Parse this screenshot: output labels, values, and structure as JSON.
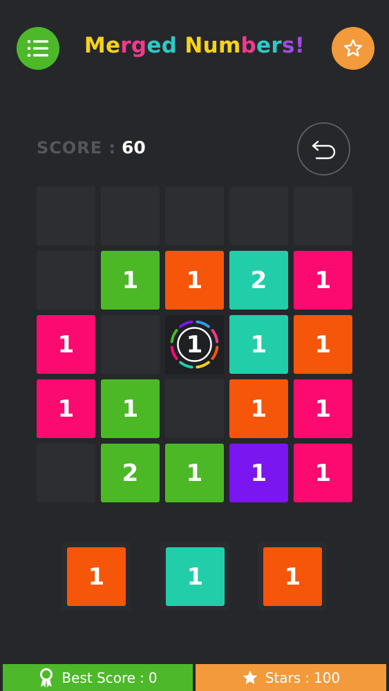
{
  "header": {
    "menu_icon": "list-icon",
    "star_icon": "star-outline-icon",
    "title_letters": [
      {
        "ch": "M",
        "color": "#f6d21c"
      },
      {
        "ch": "e",
        "color": "#f6d21c"
      },
      {
        "ch": "r",
        "color": "#f23a8c"
      },
      {
        "ch": "g",
        "color": "#f23a8c"
      },
      {
        "ch": "e",
        "color": "#2ec9c6"
      },
      {
        "ch": "d",
        "color": "#2ec9c6"
      },
      {
        "ch": " ",
        "color": "#ffffff"
      },
      {
        "ch": "N",
        "color": "#f6d21c"
      },
      {
        "ch": "u",
        "color": "#f6d21c"
      },
      {
        "ch": "m",
        "color": "#f6d21c"
      },
      {
        "ch": "b",
        "color": "#f23a8c"
      },
      {
        "ch": "e",
        "color": "#2ec9c6"
      },
      {
        "ch": "r",
        "color": "#2ec9c6"
      },
      {
        "ch": "s",
        "color": "#a14be0"
      },
      {
        "ch": "!",
        "color": "#a14be0"
      }
    ]
  },
  "score": {
    "label": "SCORE :",
    "value": "60"
  },
  "undo_icon": "undo-arrow-icon",
  "colors": {
    "green": "#4cb826",
    "orange": "#f5560a",
    "teal": "#22ceaa",
    "pink": "#fb0a70",
    "purple": "#7a16f0"
  },
  "board": [
    [
      null,
      null,
      null,
      null,
      null
    ],
    [
      null,
      {
        "value": "1",
        "color": "green"
      },
      {
        "value": "1",
        "color": "orange"
      },
      {
        "value": "2",
        "color": "teal"
      },
      {
        "value": "1",
        "color": "pink"
      }
    ],
    [
      {
        "value": "1",
        "color": "pink"
      },
      null,
      {
        "value": "1",
        "color": "special"
      },
      {
        "value": "1",
        "color": "teal"
      },
      {
        "value": "1",
        "color": "orange"
      }
    ],
    [
      {
        "value": "1",
        "color": "pink"
      },
      {
        "value": "1",
        "color": "green"
      },
      null,
      {
        "value": "1",
        "color": "orange"
      },
      {
        "value": "1",
        "color": "pink"
      }
    ],
    [
      null,
      {
        "value": "2",
        "color": "green"
      },
      {
        "value": "1",
        "color": "green"
      },
      {
        "value": "1",
        "color": "purple"
      },
      {
        "value": "1",
        "color": "pink"
      }
    ]
  ],
  "tray": [
    {
      "value": "1",
      "color": "orange"
    },
    {
      "value": "1",
      "color": "teal"
    },
    {
      "value": "1",
      "color": "orange"
    }
  ],
  "footer": {
    "best_icon": "award-ribbon-icon",
    "best_label": "Best Score",
    "best_value": "0",
    "stars_icon": "star-icon",
    "stars_label": "Stars",
    "stars_value": "100",
    "separator": ":"
  }
}
